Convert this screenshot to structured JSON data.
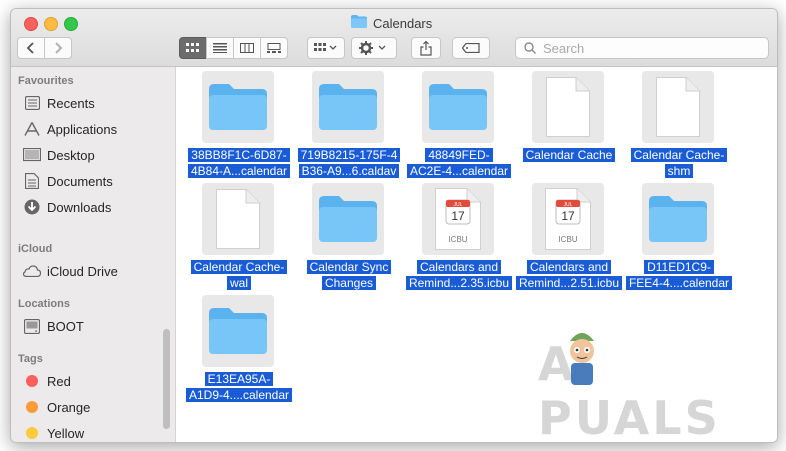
{
  "window": {
    "title": "Calendars"
  },
  "toolbar": {
    "view_modes": [
      "icon-view",
      "list-view",
      "column-view",
      "gallery-view"
    ],
    "group_icon": "grid-group-icon",
    "action_icon": "gear-icon",
    "share_icon": "share-icon",
    "tag_icon": "tag-icon"
  },
  "search": {
    "placeholder": "Search"
  },
  "sidebar": {
    "favourites_header": "Favourites",
    "favourites": [
      {
        "label": "Recents",
        "icon": "recents-icon"
      },
      {
        "label": "Applications",
        "icon": "applications-icon"
      },
      {
        "label": "Desktop",
        "icon": "desktop-icon"
      },
      {
        "label": "Documents",
        "icon": "documents-icon"
      },
      {
        "label": "Downloads",
        "icon": "downloads-icon"
      }
    ],
    "icloud_header": "iCloud",
    "icloud": [
      {
        "label": "iCloud Drive",
        "icon": "cloud-icon"
      }
    ],
    "locations_header": "Locations",
    "locations": [
      {
        "label": "BOOT",
        "icon": "disk-icon"
      }
    ],
    "tags_header": "Tags",
    "tags": [
      {
        "label": "Red",
        "color": "#fc605b"
      },
      {
        "label": "Orange",
        "color": "#fd9a3a"
      },
      {
        "label": "Yellow",
        "color": "#fdcb3b"
      }
    ]
  },
  "files": [
    {
      "line1": "38BB8F1C-6D87-",
      "line2": "4B84-A...calendar",
      "kind": "folder"
    },
    {
      "line1": "719B8215-175F-4",
      "line2": "B36-A9...6.caldav",
      "kind": "folder"
    },
    {
      "line1": "48849FED-",
      "line2": "AC2E-4...calendar",
      "kind": "folder"
    },
    {
      "line1": "Calendar Cache",
      "line2": "",
      "kind": "document"
    },
    {
      "line1": "Calendar Cache-",
      "line2": "shm",
      "kind": "document"
    },
    {
      "line1": "Calendar Cache-",
      "line2": "wal",
      "kind": "document"
    },
    {
      "line1": "Calendar Sync",
      "line2": "Changes",
      "kind": "folder"
    },
    {
      "line1": "Calendars and",
      "line2": "Remind...2.35.icbu",
      "kind": "calendar",
      "badge": "ICBU",
      "month": "JUL",
      "day": "17"
    },
    {
      "line1": "Calendars and",
      "line2": "Remind...2.51.icbu",
      "kind": "calendar",
      "badge": "ICBU",
      "month": "JUL",
      "day": "17"
    },
    {
      "line1": "D11ED1C9-",
      "line2": "FEE4-4....calendar",
      "kind": "folder"
    },
    {
      "line1": "E13EA95A-",
      "line2": "A1D9-4....calendar",
      "kind": "folder"
    }
  ],
  "watermark": {
    "text": "A PUALS"
  }
}
